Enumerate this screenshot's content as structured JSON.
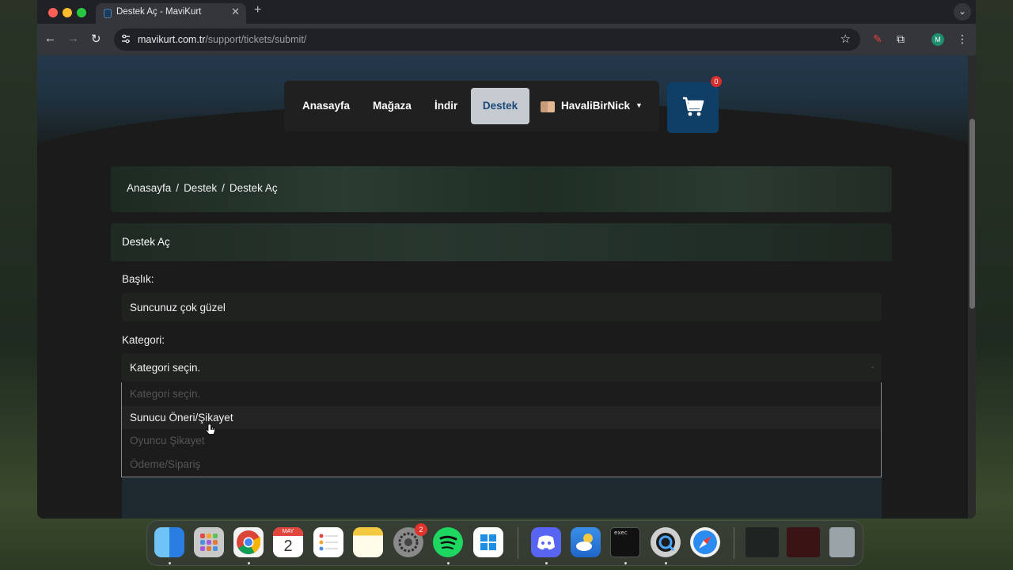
{
  "browser": {
    "tab_title": "Destek Aç - MaviKurt",
    "url_domain": "mavikurt.com.tr",
    "url_path": "/support/tickets/submit/",
    "profile_initial": "M"
  },
  "nav": {
    "items": [
      "Anasayfa",
      "Mağaza",
      "İndir",
      "Destek"
    ],
    "active": "Destek",
    "username": "HavaliBirNick",
    "cart_count": "0"
  },
  "breadcrumb": [
    "Anasayfa",
    "Destek",
    "Destek Aç"
  ],
  "card": {
    "title": "Destek Aç",
    "title_label": "Başlık:",
    "title_value": "Suncunuz çok güzel",
    "category_label": "Kategori:",
    "category_selected": "Kategori seçin.",
    "category_options": [
      "Kategori seçin.",
      "Sunucu Öneri/Şikayet",
      "Oyuncu Şikayet",
      "Ödeme/Sipariş"
    ],
    "highlighted_option": "Sunucu Öneri/Şikayet"
  },
  "dock": {
    "calendar_month": "MAY",
    "calendar_day": "2",
    "settings_badge": "2",
    "terminal_text": "exec",
    "apps": [
      "finder-icon",
      "launchpad-icon",
      "chrome-icon",
      "calendar-icon",
      "reminders-icon",
      "notes-icon",
      "settings-icon",
      "spotify-icon",
      "windows-app-icon",
      "discord-icon",
      "weather-icon",
      "terminal-icon",
      "quicktime-icon",
      "safari-icon",
      "trash-icon"
    ]
  },
  "colors": {
    "accent": "#0f3f67",
    "active_nav_bg": "#c5cbd1",
    "badge": "#d42f2f"
  }
}
